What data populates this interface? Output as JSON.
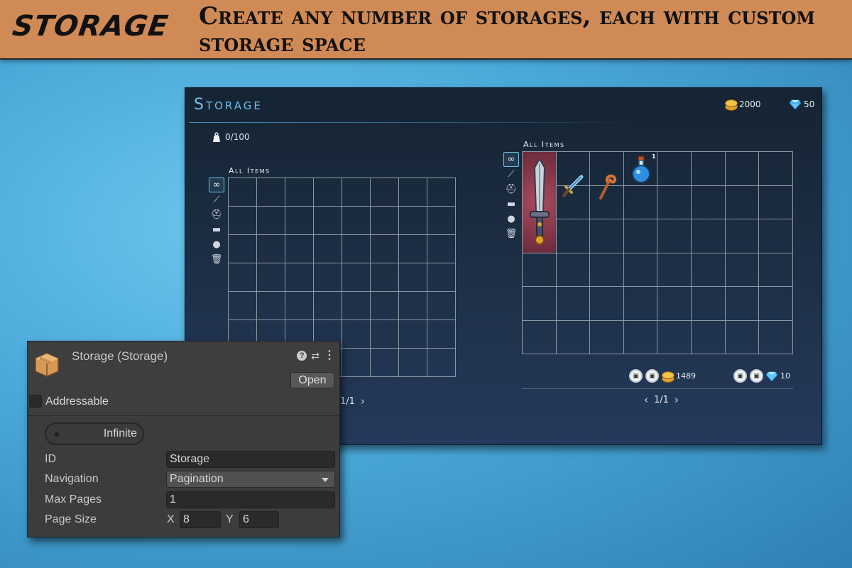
{
  "banner": {
    "logo": "STORAGE",
    "headline": "Create any number of storages, each with custom storage space"
  },
  "panel": {
    "title": "Storage",
    "currency": {
      "gold": "2000",
      "gems": "50"
    },
    "left": {
      "weight": "0/100",
      "section_label": "All Items",
      "grid": {
        "columns": 8,
        "rows": 7
      },
      "pagination": "1/1"
    },
    "right": {
      "section_label": "All Items",
      "grid": {
        "columns": 8,
        "rows": 6
      },
      "items": [
        "long-sword",
        "short-sword",
        "staff",
        "potion"
      ],
      "potion_count": "1",
      "gold_total": "1489",
      "gem_total": "10",
      "pagination": "1/1"
    },
    "filters": [
      "infinity-icon",
      "sword-icon",
      "helmet-icon",
      "scroll-icon",
      "potion-icon",
      "trash-icon"
    ],
    "colors": {
      "title": "#6fbde8",
      "grid_line": "#8c96a3",
      "rare_slot": "#7e3346"
    }
  },
  "inspector": {
    "title": "Storage (Storage)",
    "open_button": "Open",
    "addressable_label": "Addressable",
    "toggle_label": "Infinite",
    "properties": {
      "id_label": "ID",
      "id_value": "Storage",
      "navigation_label": "Navigation",
      "navigation_value": "Pagination",
      "max_pages_label": "Max Pages",
      "max_pages_value": "1",
      "page_size_label": "Page Size",
      "x_label": "X",
      "x_value": "8",
      "y_label": "Y",
      "y_value": "6"
    }
  }
}
